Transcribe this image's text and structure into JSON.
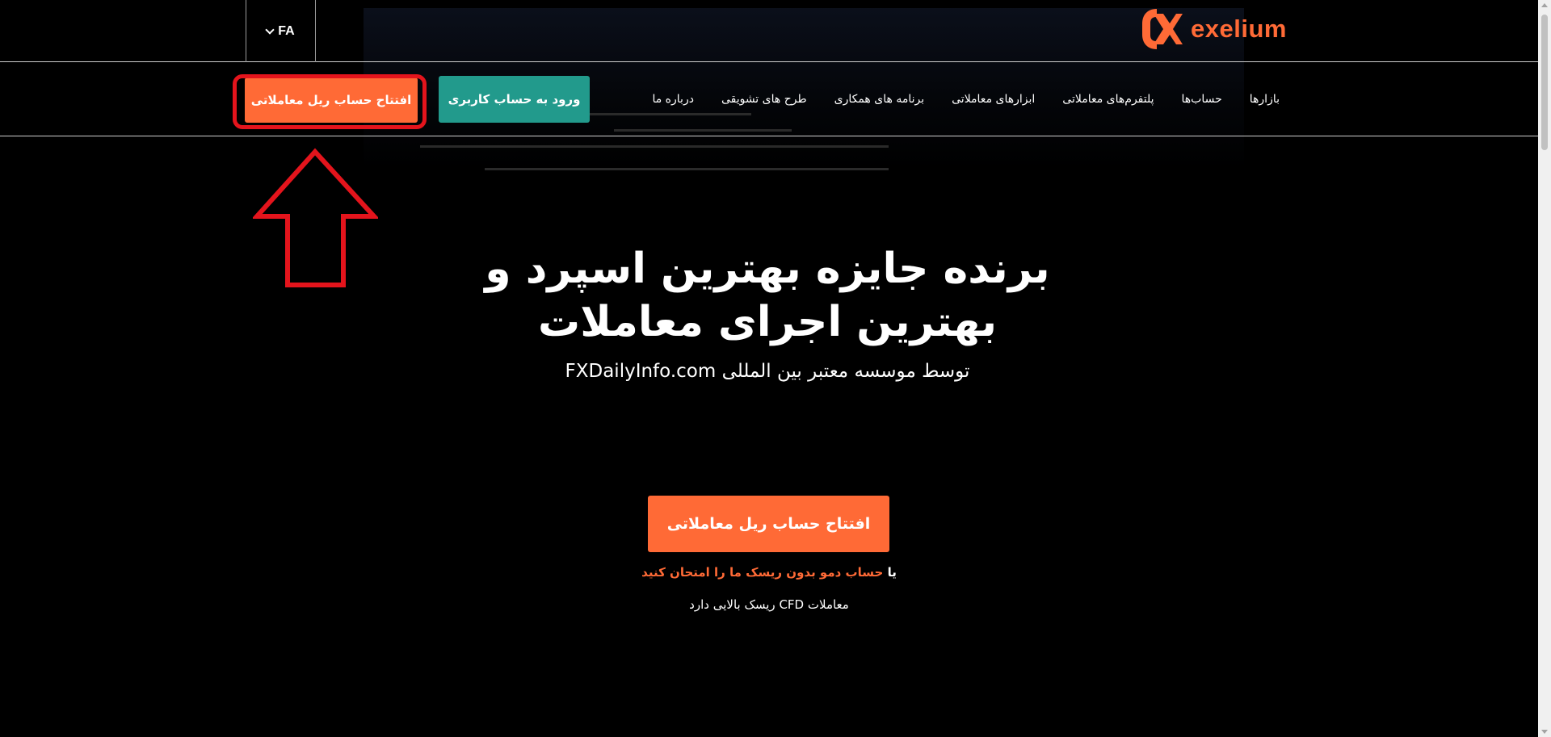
{
  "header": {
    "language": "FA",
    "logo_text": "exelium",
    "brand_color": "#ff6a36"
  },
  "nav": {
    "items": [
      {
        "label": "بازارها"
      },
      {
        "label": "حساب‌ها"
      },
      {
        "label": "پلتفرم‌های معاملاتی"
      },
      {
        "label": "ابزارهای معاملاتی"
      },
      {
        "label": "برنامه های همکاری"
      },
      {
        "label": "طرح های تشویقی"
      },
      {
        "label": "درباره ما"
      }
    ],
    "login_label": "ورود به حساب کاربری",
    "open_account_label": "افتتاح حساب ریل معاملاتی",
    "login_color": "#229a8c"
  },
  "hero": {
    "title_line1": "برنده جایزه بهترین اسپرد و",
    "title_line2": "بهترین اجرای معاملات",
    "subtitle": "توسط موسسه معتبر بین المللی FXDailyInfo.com",
    "cta_label": "افتتاح حساب ریل معاملاتی",
    "demo_prefix": "یا",
    "demo_link": "حساب دمو بدون ریسک ما را امتحان کنید",
    "risk_notice": "معاملات CFD ریسک بالایی دارد"
  },
  "annotation": {
    "highlight_color": "#e4141c",
    "icon": "arrow-up-icon"
  }
}
